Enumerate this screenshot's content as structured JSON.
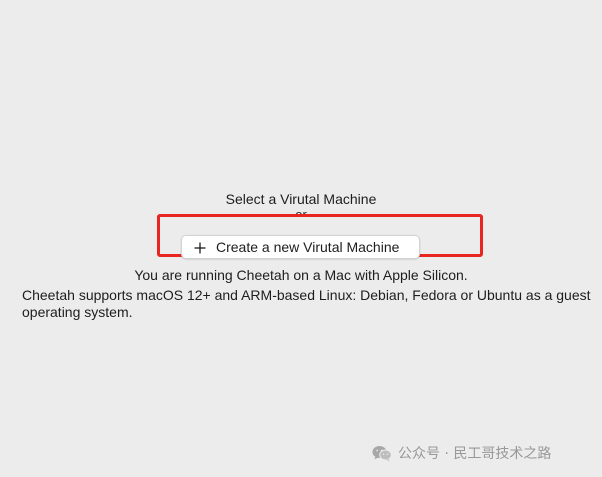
{
  "main": {
    "select_title": "Select a Virutal Machine",
    "or_text": "or",
    "create_button": {
      "icon": "plus-icon",
      "label": "Create a new Virutal Machine"
    },
    "info_line_1": "You are running Cheetah on a Mac with Apple Silicon.",
    "info_line_2": "Cheetah supports macOS 12+ and ARM-based Linux: Debian, Fedora or Ubuntu as a guest operating system."
  },
  "annotation": {
    "highlight_color": "#e8251f"
  },
  "watermark": {
    "icon": "wechat-icon",
    "text": "公众号 · 民工哥技术之路"
  },
  "colors": {
    "background": "#ececec",
    "text": "#1d1d1f",
    "watermark": "#8f8f8f"
  }
}
